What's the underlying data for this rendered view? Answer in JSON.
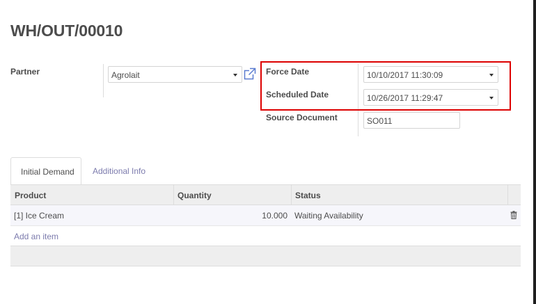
{
  "record": {
    "title": "WH/OUT/00010"
  },
  "form": {
    "partner_label": "Partner",
    "partner_value": "Agrolait",
    "force_date_label": "Force Date",
    "force_date_value": "10/10/2017 11:30:09",
    "scheduled_date_label": "Scheduled Date",
    "scheduled_date_value": "10/26/2017 11:29:47",
    "source_document_label": "Source Document",
    "source_document_value": "SO011"
  },
  "tabs": [
    {
      "label": "Initial Demand",
      "active": true
    },
    {
      "label": "Additional Info",
      "active": false
    }
  ],
  "table": {
    "headers": [
      "Product",
      "Quantity",
      "Status"
    ],
    "rows": [
      {
        "product": "[1] Ice Cream",
        "quantity": "10.000",
        "status": "Waiting Availability"
      }
    ],
    "add_item_label": "Add an item"
  },
  "colors": {
    "accent_link": "#7c7bad",
    "highlight_border": "#dd0000"
  },
  "icons": {
    "external_link": "external-link-icon",
    "delete": "trash-icon",
    "dropdown": "caret-down-icon"
  }
}
